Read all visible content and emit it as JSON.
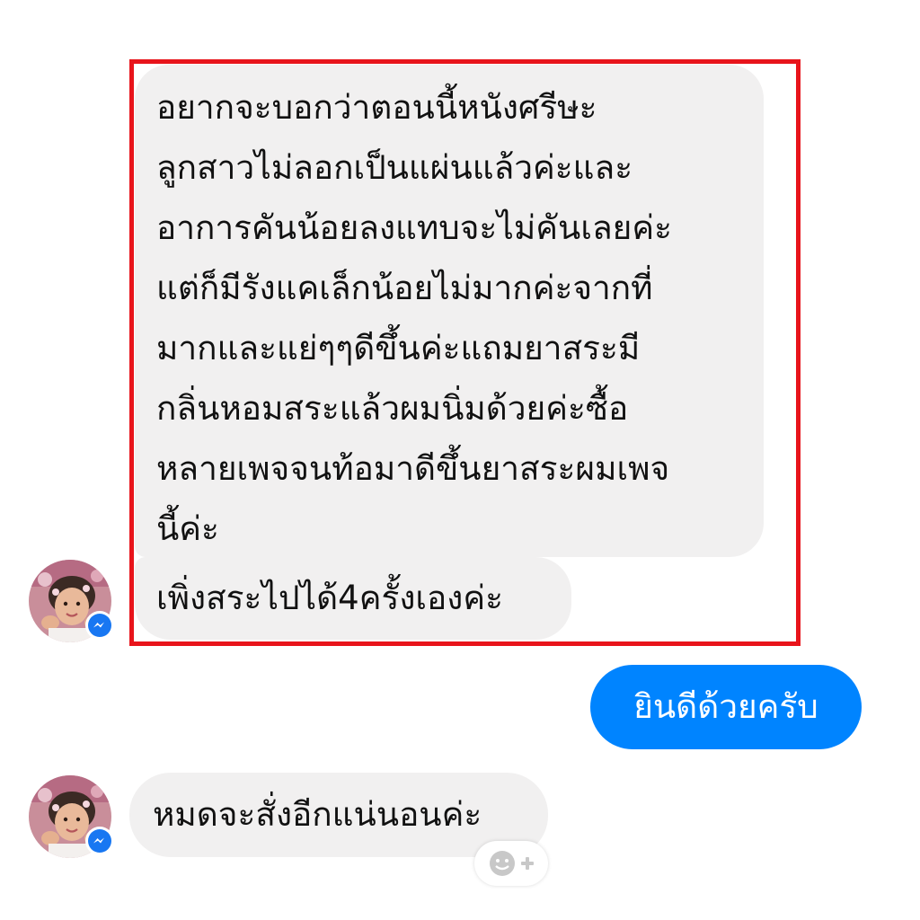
{
  "conversation": {
    "incoming_long_message": {
      "lines": [
        "อยากจะบอกว่าตอนนี้หนังศรีษะ",
        "ลูกสาวไม่ลอกเป็นแผ่นแล้วค่ะและ",
        "อาการคันน้อยลงแทบจะไม่คันเลยค่ะ",
        "แต่ก็มีรังแคเล็กน้อยไม่มากค่ะจากที่",
        "มากและแย่ๆๆดีขึ้นค่ะแถมยาสระมี",
        "กลิ่นหอมสระแล้วผมนิ่มด้วยค่ะซื้อ",
        "หลายเพจจนท้อมาดีขึ้นยาสระผมเพจ",
        "นี้ค่ะ"
      ]
    },
    "incoming_short_message": "เพิ่งสระไปได้4ครั้งเองค่ะ",
    "outgoing_message": "ยินดีด้วยครับ",
    "incoming_last_message": "หมดจะสั่งอีกแน่นอนค่ะ"
  },
  "icons": {
    "avatar": "contact-avatar",
    "badge": "messenger-badge-icon",
    "reaction": "add-reaction-icon"
  },
  "colors": {
    "incoming_bubble": "#f1f0f0",
    "outgoing_bubble": "#0084ff",
    "highlight_border": "#e8141b",
    "messenger_badge": "#1877f2"
  }
}
